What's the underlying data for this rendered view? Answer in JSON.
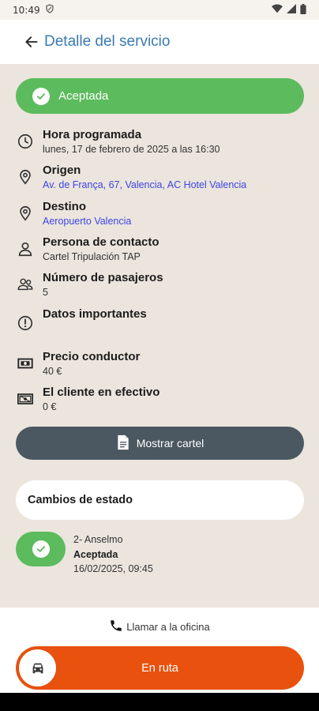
{
  "status_bar": {
    "time": "10:49"
  },
  "app_bar": {
    "title": "Detalle del servicio"
  },
  "status": {
    "label": "Aceptada",
    "color": "#5cbb5c"
  },
  "details": [
    {
      "icon": "clock-icon",
      "title": "Hora programada",
      "value": "lunes, 17 de febrero de 2025 a las 16:30"
    },
    {
      "icon": "location-pin-icon",
      "title": "Origen",
      "value": "Av. de França, 67, Valencia, AC Hotel Valencia"
    },
    {
      "icon": "location-pin-icon",
      "title": "Destino",
      "value": "Aeropuerto Valencia"
    },
    {
      "icon": "person-icon",
      "title": "Persona de contacto",
      "value": "Cartel Tripulación TAP"
    },
    {
      "icon": "group-icon",
      "title": "Número de pasajeros",
      "value": "5"
    },
    {
      "icon": "info-icon",
      "title": "Datos importantes",
      "value": ""
    },
    {
      "icon": "money-icon",
      "title": "Precio conductor",
      "value": "40 €"
    },
    {
      "icon": "cash-icon",
      "title": "El cliente en efectivo",
      "value": "0 €"
    }
  ],
  "show_sign_button": {
    "label": "Mostrar cartel"
  },
  "status_changes": {
    "title": "Cambios de estado",
    "entries": [
      {
        "user": "2- Anselmo",
        "status": "Aceptada",
        "datetime": "16/02/2025, 09:45"
      }
    ]
  },
  "call_office": {
    "label": "Llamar a la oficina"
  },
  "route_button": {
    "label": "En ruta",
    "color": "#e8520e"
  }
}
